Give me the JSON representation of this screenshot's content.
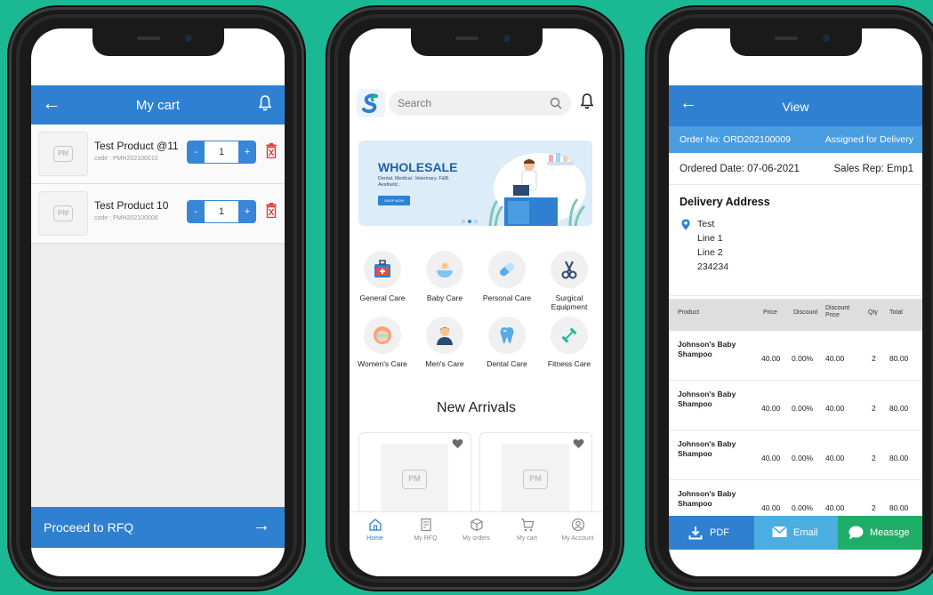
{
  "cart": {
    "title": "My cart",
    "items": [
      {
        "name": "Test Product @11",
        "code": "code : PMH202100010",
        "qty": "1"
      },
      {
        "name": "Test Product 10",
        "code": "code : PMH202100008",
        "qty": "1"
      }
    ],
    "minus": "-",
    "plus": "+",
    "thumb_logo": "PM",
    "proceed_label": "Proceed to RFQ",
    "icons": {
      "back": "arrow-left-icon",
      "bell": "bell-icon",
      "trash": "trash-icon",
      "proceed": "arrow-right-icon"
    }
  },
  "home": {
    "search_placeholder": "Search",
    "banner": {
      "headline": "WHOLESALE",
      "sub": "Dental. Medical. Veterinary. F&B. Aesthetic.",
      "cta": "SHOP NOW"
    },
    "categories": [
      {
        "label": "General Care",
        "icon": "first-aid-kit-icon"
      },
      {
        "label": "Baby Care",
        "icon": "baby-bath-icon"
      },
      {
        "label": "Personal Care",
        "icon": "capsule-icon"
      },
      {
        "label": "Surgical Equipment",
        "icon": "scissors-icon"
      },
      {
        "label": "Women's Care",
        "icon": "woman-icon"
      },
      {
        "label": "Men's Care",
        "icon": "man-icon"
      },
      {
        "label": "Dental Care",
        "icon": "tooth-icon"
      },
      {
        "label": "Fitness Care",
        "icon": "dumbbell-icon"
      }
    ],
    "new_arrivals_title": "New Arrivals",
    "product_logo": "PM",
    "nav": [
      {
        "label": "Home",
        "icon": "home-icon",
        "active": true
      },
      {
        "label": "My RFQ",
        "icon": "rfq-icon",
        "active": false
      },
      {
        "label": "My orders",
        "icon": "box-icon",
        "active": false
      },
      {
        "label": "My cart",
        "icon": "cart-icon",
        "active": false
      },
      {
        "label": "My Account",
        "icon": "account-icon",
        "active": false
      }
    ]
  },
  "order": {
    "title": "View",
    "order_no": "Order No: ORD202100009",
    "status": "Assigned for Delivery",
    "ordered_date": "Ordered Date: 07-06-2021",
    "sales_rep": "Sales Rep: Emp1",
    "address_heading": "Delivery Address",
    "address_lines": [
      "Test",
      "Line 1",
      "Line 2",
      "234234"
    ],
    "table_headers": [
      "Product",
      "Price",
      "Discount",
      "Discount Price",
      "Qty",
      "Total"
    ],
    "rows": [
      {
        "product": "Johnson's Baby Shampoo",
        "price": "40.00",
        "discount": "0.00%",
        "discount_price": "40.00",
        "qty": "2",
        "total": "80.00"
      },
      {
        "product": "Johnson's Baby Shampoo",
        "price": "40.00",
        "discount": "0.00%",
        "discount_price": "40.00",
        "qty": "2",
        "total": "80.00"
      },
      {
        "product": "Johnson's Baby Shampoo",
        "price": "40.00",
        "discount": "0.00%",
        "discount_price": "40.00",
        "qty": "2",
        "total": "80.00"
      },
      {
        "product": "Johnson's Baby Shampoo",
        "price": "40.00",
        "discount": "0.00%",
        "discount_price": "40.00",
        "qty": "2",
        "total": "80.00"
      }
    ],
    "actions": {
      "pdf": "PDF",
      "email": "Email",
      "message": "Meassge"
    }
  },
  "colors": {
    "primary": "#2f80d1",
    "background": "#1bb894",
    "success": "#1fae68",
    "danger": "#e53935"
  }
}
